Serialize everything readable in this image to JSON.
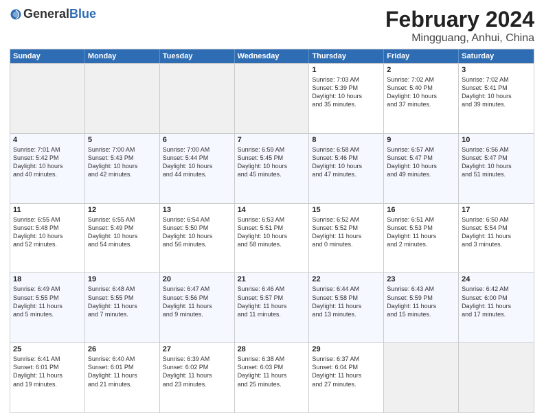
{
  "header": {
    "logo_general": "General",
    "logo_blue": "Blue",
    "main_title": "February 2024",
    "sub_title": "Mingguang, Anhui, China"
  },
  "weekdays": [
    "Sunday",
    "Monday",
    "Tuesday",
    "Wednesday",
    "Thursday",
    "Friday",
    "Saturday"
  ],
  "rows": [
    [
      {
        "day": "",
        "info": ""
      },
      {
        "day": "",
        "info": ""
      },
      {
        "day": "",
        "info": ""
      },
      {
        "day": "",
        "info": ""
      },
      {
        "day": "1",
        "info": "Sunrise: 7:03 AM\nSunset: 5:39 PM\nDaylight: 10 hours\nand 35 minutes."
      },
      {
        "day": "2",
        "info": "Sunrise: 7:02 AM\nSunset: 5:40 PM\nDaylight: 10 hours\nand 37 minutes."
      },
      {
        "day": "3",
        "info": "Sunrise: 7:02 AM\nSunset: 5:41 PM\nDaylight: 10 hours\nand 39 minutes."
      }
    ],
    [
      {
        "day": "4",
        "info": "Sunrise: 7:01 AM\nSunset: 5:42 PM\nDaylight: 10 hours\nand 40 minutes."
      },
      {
        "day": "5",
        "info": "Sunrise: 7:00 AM\nSunset: 5:43 PM\nDaylight: 10 hours\nand 42 minutes."
      },
      {
        "day": "6",
        "info": "Sunrise: 7:00 AM\nSunset: 5:44 PM\nDaylight: 10 hours\nand 44 minutes."
      },
      {
        "day": "7",
        "info": "Sunrise: 6:59 AM\nSunset: 5:45 PM\nDaylight: 10 hours\nand 45 minutes."
      },
      {
        "day": "8",
        "info": "Sunrise: 6:58 AM\nSunset: 5:46 PM\nDaylight: 10 hours\nand 47 minutes."
      },
      {
        "day": "9",
        "info": "Sunrise: 6:57 AM\nSunset: 5:47 PM\nDaylight: 10 hours\nand 49 minutes."
      },
      {
        "day": "10",
        "info": "Sunrise: 6:56 AM\nSunset: 5:47 PM\nDaylight: 10 hours\nand 51 minutes."
      }
    ],
    [
      {
        "day": "11",
        "info": "Sunrise: 6:55 AM\nSunset: 5:48 PM\nDaylight: 10 hours\nand 52 minutes."
      },
      {
        "day": "12",
        "info": "Sunrise: 6:55 AM\nSunset: 5:49 PM\nDaylight: 10 hours\nand 54 minutes."
      },
      {
        "day": "13",
        "info": "Sunrise: 6:54 AM\nSunset: 5:50 PM\nDaylight: 10 hours\nand 56 minutes."
      },
      {
        "day": "14",
        "info": "Sunrise: 6:53 AM\nSunset: 5:51 PM\nDaylight: 10 hours\nand 58 minutes."
      },
      {
        "day": "15",
        "info": "Sunrise: 6:52 AM\nSunset: 5:52 PM\nDaylight: 11 hours\nand 0 minutes."
      },
      {
        "day": "16",
        "info": "Sunrise: 6:51 AM\nSunset: 5:53 PM\nDaylight: 11 hours\nand 2 minutes."
      },
      {
        "day": "17",
        "info": "Sunrise: 6:50 AM\nSunset: 5:54 PM\nDaylight: 11 hours\nand 3 minutes."
      }
    ],
    [
      {
        "day": "18",
        "info": "Sunrise: 6:49 AM\nSunset: 5:55 PM\nDaylight: 11 hours\nand 5 minutes."
      },
      {
        "day": "19",
        "info": "Sunrise: 6:48 AM\nSunset: 5:55 PM\nDaylight: 11 hours\nand 7 minutes."
      },
      {
        "day": "20",
        "info": "Sunrise: 6:47 AM\nSunset: 5:56 PM\nDaylight: 11 hours\nand 9 minutes."
      },
      {
        "day": "21",
        "info": "Sunrise: 6:46 AM\nSunset: 5:57 PM\nDaylight: 11 hours\nand 11 minutes."
      },
      {
        "day": "22",
        "info": "Sunrise: 6:44 AM\nSunset: 5:58 PM\nDaylight: 11 hours\nand 13 minutes."
      },
      {
        "day": "23",
        "info": "Sunrise: 6:43 AM\nSunset: 5:59 PM\nDaylight: 11 hours\nand 15 minutes."
      },
      {
        "day": "24",
        "info": "Sunrise: 6:42 AM\nSunset: 6:00 PM\nDaylight: 11 hours\nand 17 minutes."
      }
    ],
    [
      {
        "day": "25",
        "info": "Sunrise: 6:41 AM\nSunset: 6:01 PM\nDaylight: 11 hours\nand 19 minutes."
      },
      {
        "day": "26",
        "info": "Sunrise: 6:40 AM\nSunset: 6:01 PM\nDaylight: 11 hours\nand 21 minutes."
      },
      {
        "day": "27",
        "info": "Sunrise: 6:39 AM\nSunset: 6:02 PM\nDaylight: 11 hours\nand 23 minutes."
      },
      {
        "day": "28",
        "info": "Sunrise: 6:38 AM\nSunset: 6:03 PM\nDaylight: 11 hours\nand 25 minutes."
      },
      {
        "day": "29",
        "info": "Sunrise: 6:37 AM\nSunset: 6:04 PM\nDaylight: 11 hours\nand 27 minutes."
      },
      {
        "day": "",
        "info": ""
      },
      {
        "day": "",
        "info": ""
      }
    ]
  ]
}
